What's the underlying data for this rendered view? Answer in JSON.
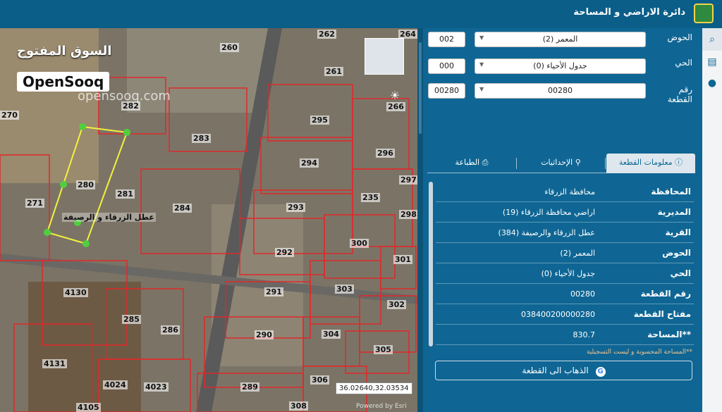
{
  "header": {
    "title": "دائرة الاراضي و المساحة"
  },
  "map": {
    "watermark_ar": "السوق المفتوح",
    "brand": "OpenSooq",
    "watermark_en": "opensooq.com",
    "coords": "36.02640,32.03534",
    "attribution": "Powered by Esri",
    "parcel_labels": [
      "262",
      "264",
      "260",
      "261",
      "282",
      "266",
      "270",
      "295",
      "283",
      "296",
      "294",
      "280",
      "281",
      "297",
      "271",
      "284",
      "293",
      "235",
      "298",
      "300",
      "292",
      "301",
      "4130",
      "291",
      "303",
      "302",
      "285",
      "286",
      "290",
      "304",
      "305",
      "4131",
      "4024",
      "4023",
      "289",
      "306",
      "4105",
      "308"
    ],
    "annotation": "عطل الزرقاء و الرصيفة"
  },
  "form": {
    "basin_label": "الحوض",
    "basin_value": "المعمر (2)",
    "basin_code": "002",
    "district_label": "الحي",
    "district_value": "جدول الأحياء (0)",
    "district_code": "000",
    "parcel_label": "رقم القطعة",
    "parcel_value": "00280",
    "parcel_code": "00280"
  },
  "tabs": {
    "info": "معلومات القطعة",
    "coords": "الإحداثيات",
    "print": "الطباعة"
  },
  "info_rows": [
    {
      "k": "المحافظة",
      "v": "محافظة الزرقاء"
    },
    {
      "k": "المديرية",
      "v": "اراضي محافظة الزرقاء (19)"
    },
    {
      "k": "القرية",
      "v": "عطل الزرقاء والرصيفة (384)"
    },
    {
      "k": "الحوض",
      "v": "المعمر (2)"
    },
    {
      "k": "الحي",
      "v": "جدول الأحياء (0)"
    },
    {
      "k": "رقم القطعة",
      "v": "00280"
    },
    {
      "k": "مفتاح القطعة",
      "v": "038400200000280"
    },
    {
      "k": "**المساحة",
      "v": "830.7"
    }
  ],
  "note": "**المساحة المحسوبة و ليست التسجيلية",
  "goto_button": "الذهاب الى القطعة",
  "icons": [
    "search-icon",
    "layers-icon",
    "location-pin-icon",
    "sun-icon",
    "info-icon",
    "person-pin-icon",
    "printer-icon",
    "google-icon"
  ]
}
